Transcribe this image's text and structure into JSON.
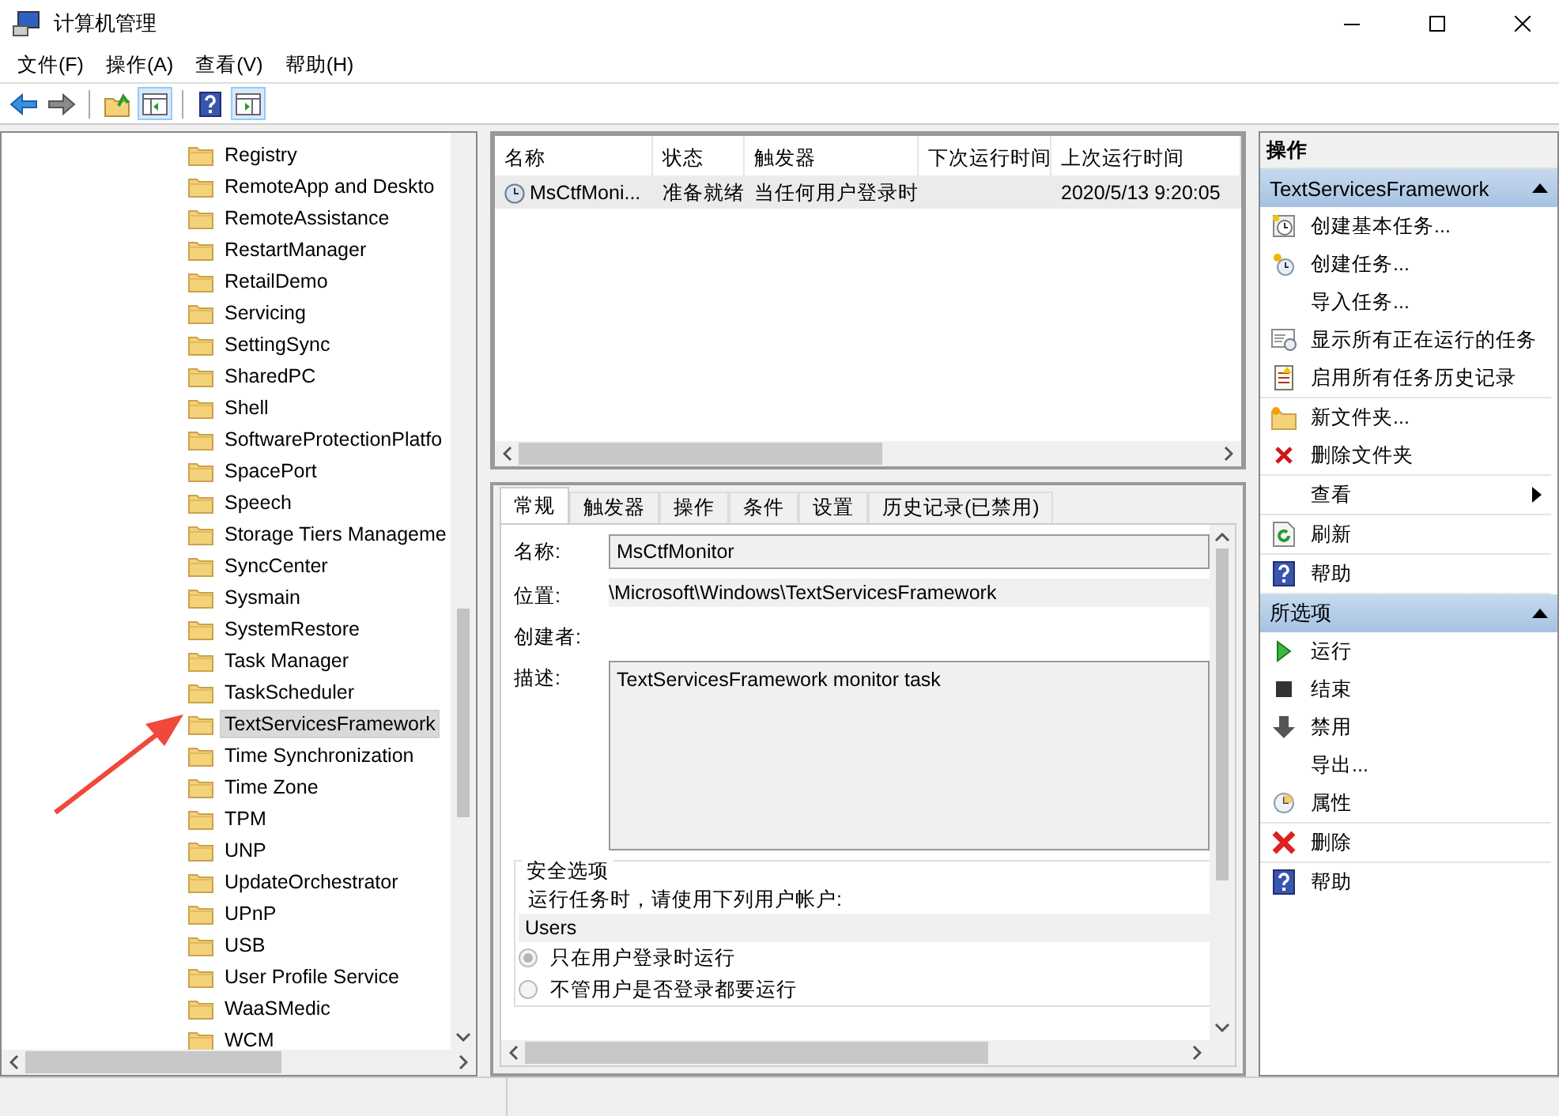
{
  "window": {
    "title": "计算机管理"
  },
  "menu": [
    {
      "label": "文件(F)"
    },
    {
      "label": "操作(A)"
    },
    {
      "label": "查看(V)"
    },
    {
      "label": "帮助(H)"
    }
  ],
  "toolbar": [
    {
      "kind": "back",
      "pressed": false
    },
    {
      "kind": "forward",
      "pressed": false
    },
    {
      "kind": "separator"
    },
    {
      "kind": "up-folder",
      "pressed": false
    },
    {
      "kind": "tree-toggle",
      "pressed": true
    },
    {
      "kind": "separator"
    },
    {
      "kind": "help",
      "pressed": false
    },
    {
      "kind": "pane-toggle",
      "pressed": true
    }
  ],
  "tree": {
    "items": [
      {
        "label": "Registry",
        "selected": false
      },
      {
        "label": "RemoteApp and Deskto",
        "selected": false
      },
      {
        "label": "RemoteAssistance",
        "selected": false
      },
      {
        "label": "RestartManager",
        "selected": false
      },
      {
        "label": "RetailDemo",
        "selected": false
      },
      {
        "label": "Servicing",
        "selected": false
      },
      {
        "label": "SettingSync",
        "selected": false
      },
      {
        "label": "SharedPC",
        "selected": false
      },
      {
        "label": "Shell",
        "selected": false
      },
      {
        "label": "SoftwareProtectionPlatfo",
        "selected": false
      },
      {
        "label": "SpacePort",
        "selected": false
      },
      {
        "label": "Speech",
        "selected": false
      },
      {
        "label": "Storage Tiers Manageme",
        "selected": false
      },
      {
        "label": "SyncCenter",
        "selected": false
      },
      {
        "label": "Sysmain",
        "selected": false
      },
      {
        "label": "SystemRestore",
        "selected": false
      },
      {
        "label": "Task Manager",
        "selected": false
      },
      {
        "label": "TaskScheduler",
        "selected": false
      },
      {
        "label": "TextServicesFramework",
        "selected": true
      },
      {
        "label": "Time Synchronization",
        "selected": false
      },
      {
        "label": "Time Zone",
        "selected": false
      },
      {
        "label": "TPM",
        "selected": false
      },
      {
        "label": "UNP",
        "selected": false
      },
      {
        "label": "UpdateOrchestrator",
        "selected": false
      },
      {
        "label": "UPnP",
        "selected": false
      },
      {
        "label": "USB",
        "selected": false
      },
      {
        "label": "User Profile Service",
        "selected": false
      },
      {
        "label": "WaaSMedic",
        "selected": false
      },
      {
        "label": "WCM",
        "selected": false
      }
    ]
  },
  "task_list": {
    "columns": [
      "名称",
      "状态",
      "触发器",
      "下次运行时间",
      "上次运行时间"
    ],
    "rows": [
      {
        "cells": [
          "MsCtfMoni...",
          "准备就绪",
          "当任何用户登录时",
          null,
          "2020/5/13 9:20:05"
        ],
        "selected": true
      }
    ]
  },
  "detail_tabs": [
    {
      "label": "常规",
      "selected": true
    },
    {
      "label": "触发器",
      "selected": false
    },
    {
      "label": "操作",
      "selected": false
    },
    {
      "label": "条件",
      "selected": false
    },
    {
      "label": "设置",
      "selected": false
    },
    {
      "label": "历史记录(已禁用)",
      "selected": false
    }
  ],
  "general": {
    "fields": [
      {
        "label": "名称:",
        "value": "MsCtfMonitor",
        "kind": "box"
      },
      {
        "label": "位置:",
        "value": "\\Microsoft\\Windows\\TextServicesFramework",
        "kind": "plain"
      },
      {
        "label": "创建者:",
        "kind": "plain"
      },
      {
        "label": "描述:",
        "value": "TextServicesFramework monitor task",
        "kind": "area"
      }
    ],
    "security": {
      "title": "安全选项",
      "prompt": "运行任务时，请使用下列用户帐户:",
      "account": "Users",
      "options": [
        {
          "label": "只在用户登录时运行",
          "selected": true
        },
        {
          "label": "不管用户是否登录都要运行",
          "selected": false
        }
      ]
    }
  },
  "actions": {
    "title": "操作",
    "sections": [
      {
        "title": "TextServicesFramework",
        "expanded": true,
        "groups": [
          [
            {
              "label": "创建基本任务...",
              "kind": "basic-task"
            },
            {
              "label": "创建任务...",
              "kind": "new-task"
            },
            {
              "label": "导入任务...",
              "kind": "plain"
            },
            {
              "label": "显示所有正在运行的任务",
              "kind": "running"
            },
            {
              "label": "启用所有任务历史记录",
              "kind": "history"
            }
          ],
          [
            {
              "label": "新文件夹...",
              "kind": "new-folder"
            },
            {
              "label": "删除文件夹",
              "kind": "delete-small"
            }
          ],
          [
            {
              "label": "查看",
              "kind": "submenu"
            }
          ],
          [
            {
              "label": "刷新",
              "kind": "refresh"
            }
          ],
          [
            {
              "label": "帮助",
              "kind": "help"
            }
          ]
        ]
      },
      {
        "title": "所选项",
        "expanded": true,
        "groups": [
          [
            {
              "label": "运行",
              "kind": "run"
            },
            {
              "label": "结束",
              "kind": "stop"
            },
            {
              "label": "禁用",
              "kind": "disable"
            },
            {
              "label": "导出...",
              "kind": "plain"
            },
            {
              "label": "属性",
              "kind": "properties"
            }
          ],
          [
            {
              "label": "删除",
              "kind": "delete-big"
            }
          ],
          [
            {
              "label": "帮助",
              "kind": "help"
            }
          ]
        ]
      }
    ]
  }
}
